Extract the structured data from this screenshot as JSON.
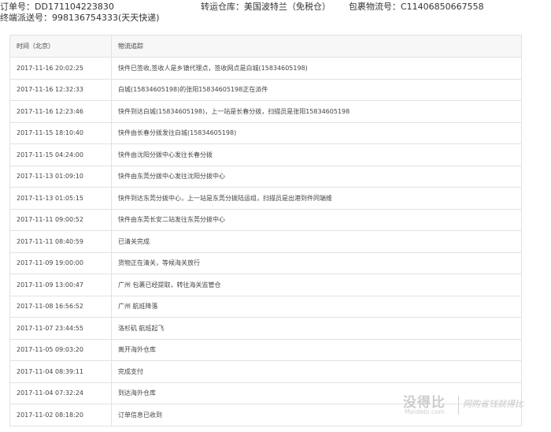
{
  "header": {
    "order_label": "订单号：",
    "order_no": "DD171104223830",
    "warehouse_label": "转运仓库：",
    "warehouse": "美国波特兰（免税仓）",
    "tracking_label": "包裹物流号：",
    "tracking_no": "C11406850667558",
    "final_label": "终端派送号：",
    "final_no": "998136754333(天天快递)"
  },
  "table": {
    "columns": [
      "时间（北京）",
      "物流追踪"
    ],
    "rows": [
      {
        "time": "2017-11-16 20:02:25",
        "detail": "快件已签收,签收人是乡镇代理点，签收网点是白城(15834605198)"
      },
      {
        "time": "2017-11-16 12:32:33",
        "detail": "白城(15834605198)的张阳15834605198正在派件"
      },
      {
        "time": "2017-11-16 12:23:46",
        "detail": "快件到达白城(15834605198)，上一站是长春分拨，扫描员是张阳15834605198"
      },
      {
        "time": "2017-11-15 18:10:40",
        "detail": "快件由长春分拨发往白城(15834605198)"
      },
      {
        "time": "2017-11-15 04:24:00",
        "detail": "快件由沈阳分拨中心发往长春分拨"
      },
      {
        "time": "2017-11-13 01:09:10",
        "detail": "快件由东莞分拨中心发往沈阳分拨中心"
      },
      {
        "time": "2017-11-13 01:05:15",
        "detail": "快件到达东莞分拨中心，上一站是东莞分拨陆运组，扫描员是出港到件同端维"
      },
      {
        "time": "2017-11-11 09:00:52",
        "detail": "快件由东莞长安二站发往东莞分拨中心"
      },
      {
        "time": "2017-11-11 08:40:59",
        "detail": "已清关完成"
      },
      {
        "time": "2017-11-09 19:00:00",
        "detail": "货物正在清关，等候海关放行"
      },
      {
        "time": "2017-11-09 13:00:47",
        "detail": "广州 包裹已经提取，转往海关监管仓"
      },
      {
        "time": "2017-11-08 16:56:52",
        "detail": "广州 航班降落"
      },
      {
        "time": "2017-11-07 23:44:55",
        "detail": "洛杉矶 航班起飞"
      },
      {
        "time": "2017-11-05 09:03:20",
        "detail": "离开海外仓库"
      },
      {
        "time": "2017-11-04 08:39:11",
        "detail": "完成支付"
      },
      {
        "time": "2017-11-04 07:32:24",
        "detail": "到达海外仓库"
      },
      {
        "time": "2017-11-02 08:18:20",
        "detail": "订单信息已收到"
      }
    ]
  },
  "watermark": {
    "logo": "没得比",
    "site": "Meidebi.com",
    "slogan": "网购省钱就得比"
  }
}
